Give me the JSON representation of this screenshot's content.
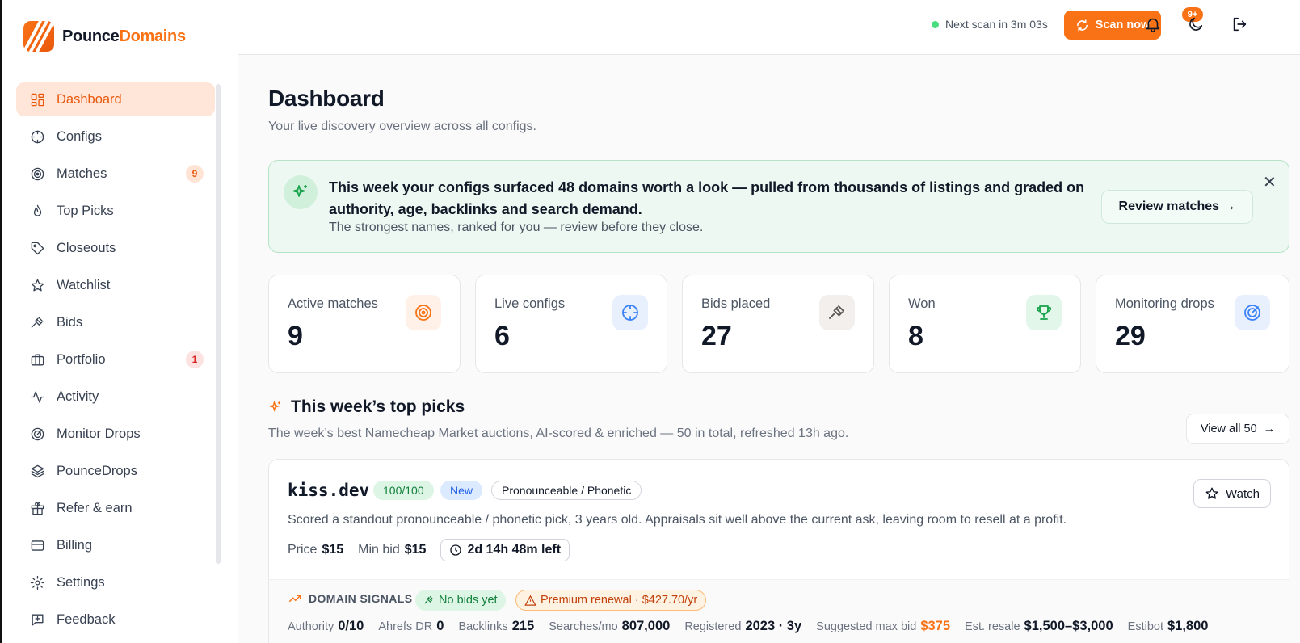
{
  "brand": {
    "name_part1": "Pounce",
    "name_part2": "Domains"
  },
  "sidebar": {
    "items": [
      {
        "label": "Dashboard",
        "icon": "dashboard-icon",
        "active": true
      },
      {
        "label": "Configs",
        "icon": "crosshair-icon"
      },
      {
        "label": "Matches",
        "icon": "target-icon",
        "badge": "9"
      },
      {
        "label": "Top Picks",
        "icon": "flame-icon"
      },
      {
        "label": "Closeouts",
        "icon": "tag-icon"
      },
      {
        "label": "Watchlist",
        "icon": "star-icon"
      },
      {
        "label": "Bids",
        "icon": "gavel-icon"
      },
      {
        "label": "Portfolio",
        "icon": "briefcase-icon",
        "badge": "1"
      },
      {
        "label": "Activity",
        "icon": "activity-icon"
      },
      {
        "label": "Monitor Drops",
        "icon": "radar-icon"
      },
      {
        "label": "PounceDrops",
        "icon": "layers-icon"
      },
      {
        "label": "Refer & earn",
        "icon": "gift-icon"
      },
      {
        "label": "Billing",
        "icon": "credit-card-icon"
      },
      {
        "label": "Settings",
        "icon": "gear-icon"
      },
      {
        "label": "Feedback",
        "icon": "message-icon"
      }
    ]
  },
  "topbar": {
    "scan_status": "Next scan in 3m 03s",
    "scan_button": "Scan now",
    "notif_count": "9+"
  },
  "page": {
    "title": "Dashboard",
    "subtitle": "Your live discovery overview across all configs."
  },
  "banner": {
    "headline": "This week your configs surfaced 48 domains worth a look — pulled from thousands of listings and graded on authority, age, backlinks and search demand.",
    "sub": "The strongest names, ranked for you — review before they close.",
    "button": "Review matches",
    "arrow": "→",
    "close": "✕"
  },
  "stats": [
    {
      "label": "Active matches",
      "value": "9",
      "icon": "target-icon",
      "color": "#f97316",
      "bg": "#fff1e8"
    },
    {
      "label": "Live configs",
      "value": "6",
      "icon": "crosshair-icon",
      "color": "#3b82f6",
      "bg": "#e8f0fe"
    },
    {
      "label": "Bids placed",
      "value": "27",
      "icon": "gavel-icon",
      "color": "#57534e",
      "bg": "#f3efec"
    },
    {
      "label": "Won",
      "value": "8",
      "icon": "trophy-icon",
      "color": "#16a34a",
      "bg": "#e3f6ea"
    },
    {
      "label": "Monitoring drops",
      "value": "29",
      "icon": "radar-icon",
      "color": "#3b82f6",
      "bg": "#e8f0fe"
    }
  ],
  "top_picks": {
    "title": "This week’s top picks",
    "subtitle": "The week’s best Namecheap Market auctions, AI-scored & enriched — 50 in total, refreshed 13h ago.",
    "view_all": "View all 50",
    "view_all_arrow": "→",
    "pick": {
      "domain": "kiss.dev",
      "score": "100/100",
      "status": "New",
      "category": "Pronounceable / Phonetic",
      "watch": "Watch",
      "description": "Scored a standout pronounceable / phonetic pick, 3 years old. Appraisals sit well above the current ask, leaving room to resell at a profit.",
      "price_label": "Price",
      "price": "$15",
      "minbid_label": "Min bid",
      "minbid": "$15",
      "time_left": "2d 14h 48m left",
      "signals_title": "DOMAIN SIGNALS",
      "chip_bids": "No bids yet",
      "chip_renewal": "Premium renewal · $427.70/yr",
      "signals": [
        {
          "label": "Authority",
          "value": "0/10"
        },
        {
          "label": "Ahrefs DR",
          "value": "0"
        },
        {
          "label": "Backlinks",
          "value": "215"
        },
        {
          "label": "Searches/mo",
          "value": "807,000"
        },
        {
          "label": "Registered",
          "value": "2023 · 3y"
        },
        {
          "label": "Suggested max bid",
          "value": "$375",
          "accent": true
        },
        {
          "label": "Est. resale",
          "value": "$1,500–$3,000"
        },
        {
          "label": "Estibot",
          "value": "$1,800"
        }
      ]
    }
  }
}
